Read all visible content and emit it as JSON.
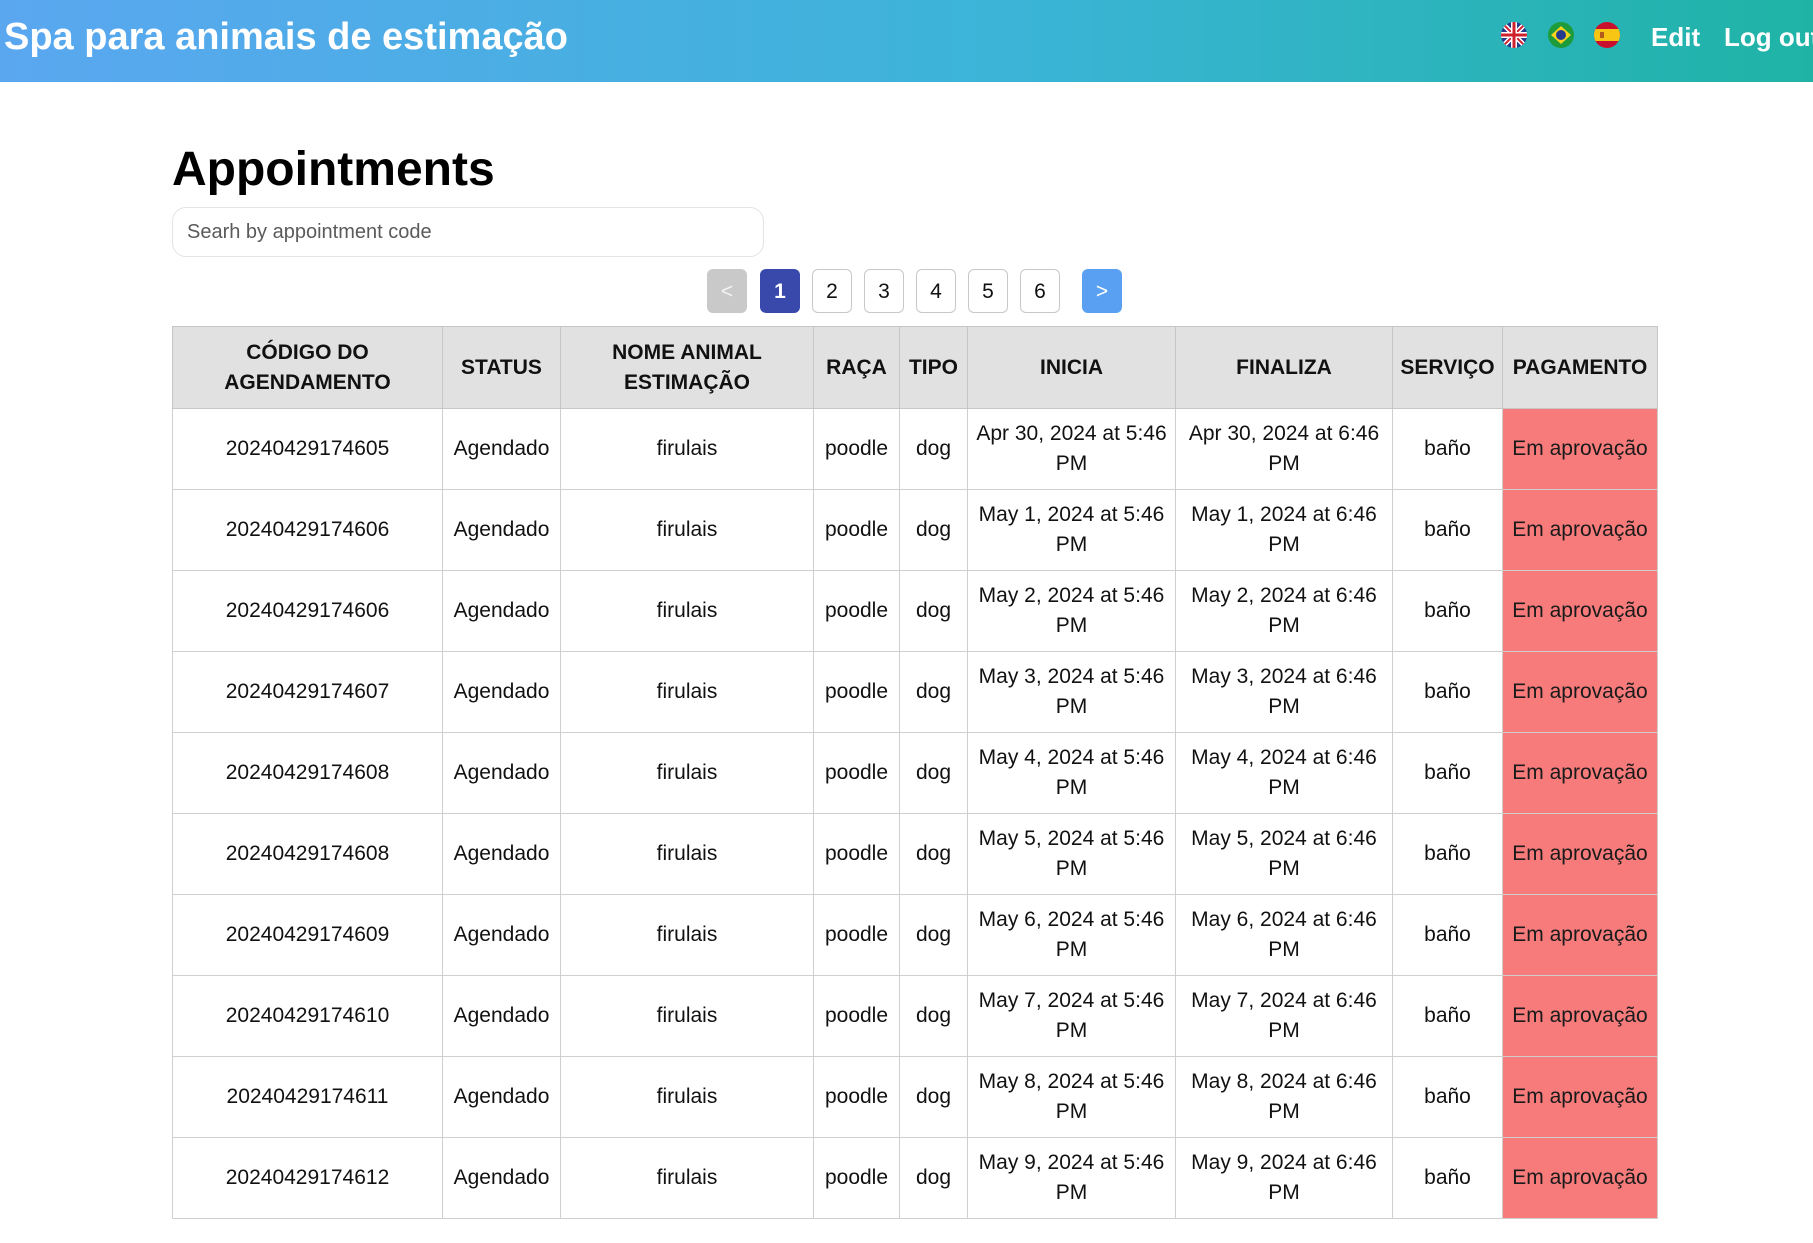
{
  "header": {
    "brand": "Spa para animais de estimação",
    "flags": [
      "uk-flag-icon",
      "brazil-flag-icon",
      "spain-flag-icon"
    ],
    "edit_label": "Edit",
    "logout_label": "Log out"
  },
  "main": {
    "title": "Appointments",
    "search": {
      "placeholder": "Searh by appointment code",
      "value": ""
    },
    "pagination": {
      "prev": "<",
      "pages": [
        "1",
        "2",
        "3",
        "4",
        "5",
        "6"
      ],
      "current": "1",
      "next": ">"
    },
    "table": {
      "headers": [
        "CÓDIGO DO AGENDAMENTO",
        "STATUS",
        "NOME ANIMAL ESTIMAÇÃO",
        "RAÇA",
        "TIPO",
        "INICIA",
        "FINALIZA",
        "SERVIÇO",
        "PAGAMENTO"
      ],
      "rows": [
        [
          "20240429174605",
          "Agendado",
          "firulais",
          "poodle",
          "dog",
          "Apr 30, 2024 at 5:46 PM",
          "Apr 30, 2024 at 6:46 PM",
          "baño",
          "Em aprovação"
        ],
        [
          "20240429174606",
          "Agendado",
          "firulais",
          "poodle",
          "dog",
          "May 1, 2024 at 5:46 PM",
          "May 1, 2024 at 6:46 PM",
          "baño",
          "Em aprovação"
        ],
        [
          "20240429174606",
          "Agendado",
          "firulais",
          "poodle",
          "dog",
          "May 2, 2024 at 5:46 PM",
          "May 2, 2024 at 6:46 PM",
          "baño",
          "Em aprovação"
        ],
        [
          "20240429174607",
          "Agendado",
          "firulais",
          "poodle",
          "dog",
          "May 3, 2024 at 5:46 PM",
          "May 3, 2024 at 6:46 PM",
          "baño",
          "Em aprovação"
        ],
        [
          "20240429174608",
          "Agendado",
          "firulais",
          "poodle",
          "dog",
          "May 4, 2024 at 5:46 PM",
          "May 4, 2024 at 6:46 PM",
          "baño",
          "Em aprovação"
        ],
        [
          "20240429174608",
          "Agendado",
          "firulais",
          "poodle",
          "dog",
          "May 5, 2024 at 5:46 PM",
          "May 5, 2024 at 6:46 PM",
          "baño",
          "Em aprovação"
        ],
        [
          "20240429174609",
          "Agendado",
          "firulais",
          "poodle",
          "dog",
          "May 6, 2024 at 5:46 PM",
          "May 6, 2024 at 6:46 PM",
          "baño",
          "Em aprovação"
        ],
        [
          "20240429174610",
          "Agendado",
          "firulais",
          "poodle",
          "dog",
          "May 7, 2024 at 5:46 PM",
          "May 7, 2024 at 6:46 PM",
          "baño",
          "Em aprovação"
        ],
        [
          "20240429174611",
          "Agendado",
          "firulais",
          "poodle",
          "dog",
          "May 8, 2024 at 5:46 PM",
          "May 8, 2024 at 6:46 PM",
          "baño",
          "Em aprovação"
        ],
        [
          "20240429174612",
          "Agendado",
          "firulais",
          "poodle",
          "dog",
          "May 9, 2024 at 5:46 PM",
          "May 9, 2024 at 6:46 PM",
          "baño",
          "Em aprovação"
        ]
      ]
    }
  },
  "colors": {
    "header_gradient_start": "#5aa7f0",
    "header_gradient_end": "#1fb3a6",
    "active_page": "#3949ab",
    "next_button": "#5aa0f2",
    "prev_button_disabled": "#c9c9c9",
    "payment_pending": "#f77b7b",
    "table_header_bg": "#e1e1e1"
  }
}
